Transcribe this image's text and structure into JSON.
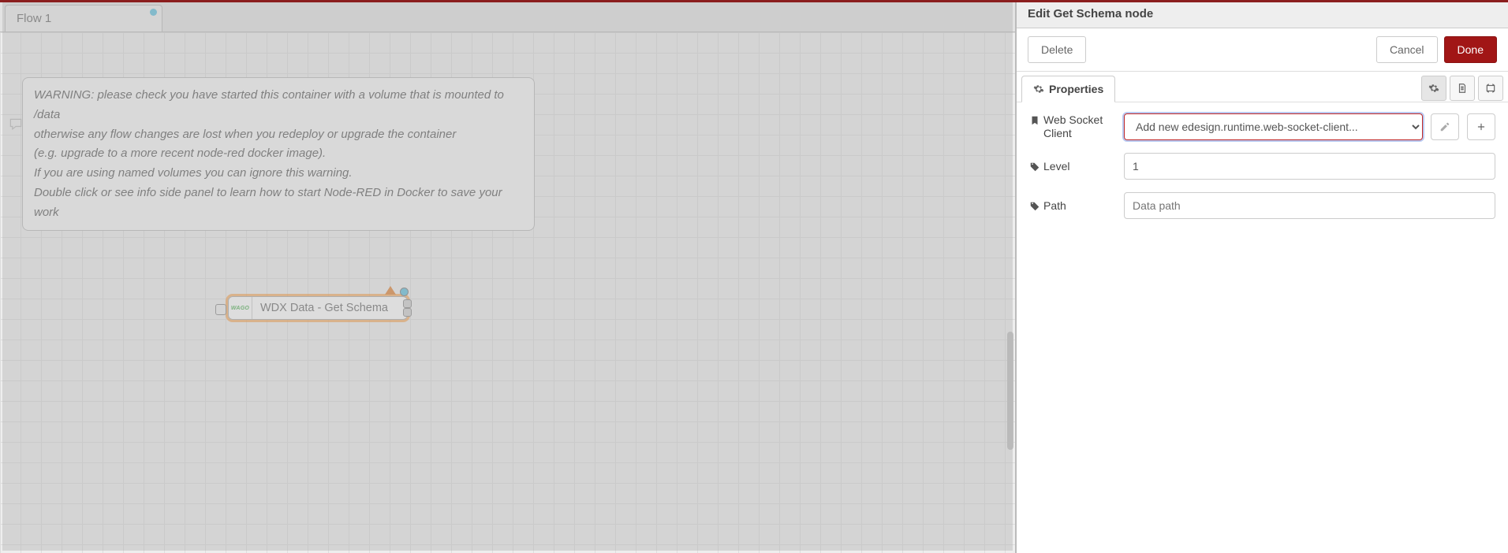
{
  "tabs": {
    "active": "Flow 1"
  },
  "comment": {
    "lines": [
      "WARNING: please check you have started this container with a volume that is mounted to /data",
      "otherwise any flow changes are lost when you redeploy or upgrade the container",
      "(e.g. upgrade to a more recent node-red docker image).",
      "If you are using named volumes you can ignore this warning.",
      "Double click or see info side panel to learn how to start Node-RED in Docker to save your work"
    ]
  },
  "node": {
    "brand": "WAGO",
    "label": "WDX Data - Get Schema"
  },
  "editor": {
    "title": "Edit Get Schema node",
    "delete": "Delete",
    "cancel": "Cancel",
    "done": "Done",
    "propertiesTab": "Properties",
    "fields": {
      "wsClient": {
        "label": "Web Socket Client",
        "value": "Add new edesign.runtime.web-socket-client..."
      },
      "level": {
        "label": "Level",
        "value": "1"
      },
      "path": {
        "label": "Path",
        "placeholder": "Data path",
        "value": ""
      }
    }
  }
}
